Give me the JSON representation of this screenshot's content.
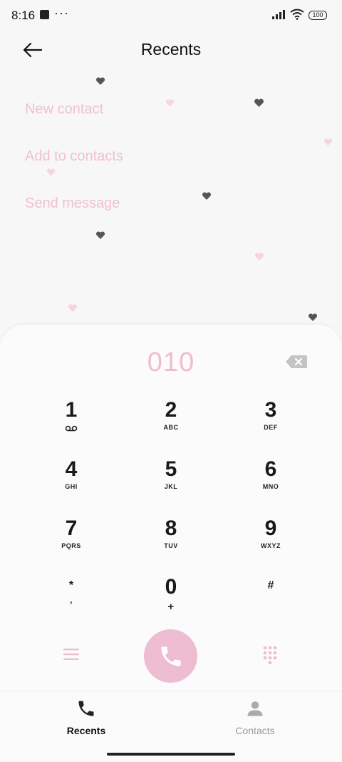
{
  "status": {
    "time": "8:16",
    "dots": "···",
    "battery": "100"
  },
  "header": {
    "title": "Recents"
  },
  "menu": {
    "items": [
      "New contact",
      "Add to contacts",
      "Send message"
    ]
  },
  "dialpad": {
    "number": "010",
    "keys": [
      {
        "digit": "1",
        "letters": ""
      },
      {
        "digit": "2",
        "letters": "ABC"
      },
      {
        "digit": "3",
        "letters": "DEF"
      },
      {
        "digit": "4",
        "letters": "GHI"
      },
      {
        "digit": "5",
        "letters": "JKL"
      },
      {
        "digit": "6",
        "letters": "MNO"
      },
      {
        "digit": "7",
        "letters": "PQRS"
      },
      {
        "digit": "8",
        "letters": "TUV"
      },
      {
        "digit": "9",
        "letters": "WXYZ"
      },
      {
        "digit": "*",
        "letters": ","
      },
      {
        "digit": "0",
        "letters": "+"
      },
      {
        "digit": "#",
        "letters": ""
      }
    ]
  },
  "nav": {
    "recents": "Recents",
    "contacts": "Contacts"
  },
  "colors": {
    "accent": "#efbdd2",
    "menu_text": "#f1bfd3"
  }
}
